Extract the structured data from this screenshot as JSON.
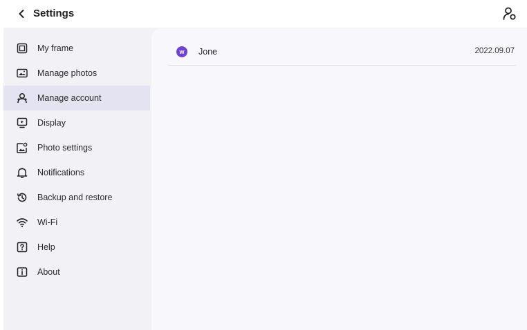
{
  "header": {
    "title": "Settings",
    "back_icon": "chevron-left-icon",
    "account_icon": "account-settings-icon"
  },
  "sidebar": {
    "items": [
      {
        "label": "My frame",
        "icon": "frame-icon",
        "active": false
      },
      {
        "label": "Manage photos",
        "icon": "photos-icon",
        "active": false
      },
      {
        "label": "Manage account",
        "icon": "account-icon",
        "active": true
      },
      {
        "label": "Display",
        "icon": "display-icon",
        "active": false
      },
      {
        "label": "Photo settings",
        "icon": "photo-settings-icon",
        "active": false
      },
      {
        "label": "Notifications",
        "icon": "bell-icon",
        "active": false
      },
      {
        "label": "Backup and restore",
        "icon": "backup-icon",
        "active": false
      },
      {
        "label": "Wi-Fi",
        "icon": "wifi-icon",
        "active": false
      },
      {
        "label": "Help",
        "icon": "help-icon",
        "active": false
      },
      {
        "label": "About",
        "icon": "info-icon",
        "active": false
      }
    ]
  },
  "accounts": [
    {
      "avatar_letter": "w",
      "name": "Jone",
      "date": "2022.09.07"
    }
  ],
  "colors": {
    "accent": "#6f3fe0",
    "active_bg": "#e4e3f1",
    "sidebar_bg": "#f1f1f6",
    "content_bg": "#f8f8fc"
  }
}
